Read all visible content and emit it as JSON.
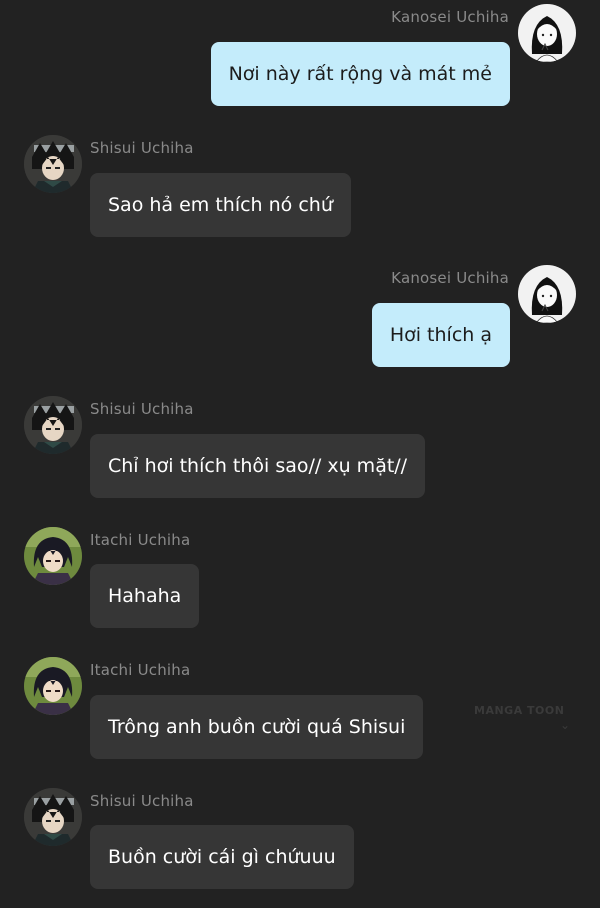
{
  "messages": [
    {
      "sender": "Kanosei Uchiha",
      "text": "Nơi này rất rộng và mát mẻ",
      "side": "right",
      "avatar_icon": "kanosei-avatar-icon"
    },
    {
      "sender": "Shisui Uchiha",
      "text": "Sao hả em thích nó chứ",
      "side": "left",
      "avatar_icon": "shisui-avatar-icon"
    },
    {
      "sender": "Kanosei Uchiha",
      "text": "Hơi thích ạ",
      "side": "right",
      "avatar_icon": "kanosei-avatar-icon"
    },
    {
      "sender": "Shisui Uchiha",
      "text": "Chỉ hơi thích thôi sao// xụ mặt//",
      "side": "left",
      "avatar_icon": "shisui-avatar-icon"
    },
    {
      "sender": "Itachi Uchiha",
      "text": "Hahaha",
      "side": "left",
      "avatar_icon": "itachi-avatar-icon"
    },
    {
      "sender": "Itachi Uchiha",
      "text": "Trông anh buồn cười quá Shisui",
      "side": "left",
      "avatar_icon": "itachi-avatar-icon"
    },
    {
      "sender": "Shisui Uchiha",
      "text": "Buồn cười cái gì chứuuu",
      "side": "left",
      "avatar_icon": "shisui-avatar-icon"
    }
  ],
  "watermark": {
    "text": "MANGA TOON"
  },
  "colors": {
    "background": "#222222",
    "incoming_bubble": "#363636",
    "outgoing_bubble": "#c4ecfb",
    "name_text": "#8a8a8a"
  }
}
